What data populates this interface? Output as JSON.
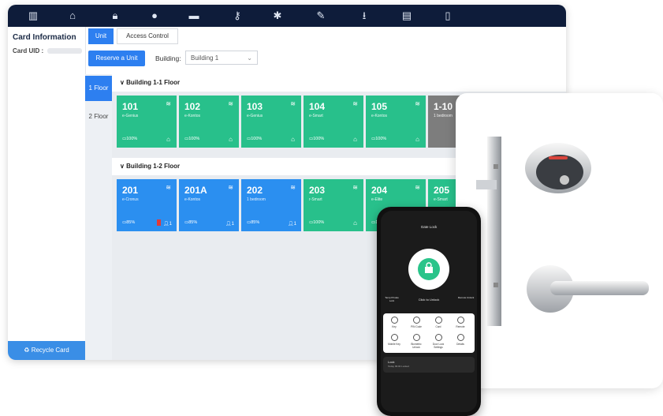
{
  "app": {
    "sidebar": {
      "title": "Card Information",
      "uid_label": "Card UID :",
      "recycle_label": "Recycle Card"
    },
    "tabs": [
      {
        "label": "Unit",
        "active": true
      },
      {
        "label": "Access Control",
        "active": false
      }
    ],
    "toolbar": {
      "reserve_label": "Reserve a Unit",
      "building_label": "Building:",
      "building_value": "Building 1"
    },
    "floors": [
      {
        "label": "1 Floor",
        "active": true
      },
      {
        "label": "2 Floor",
        "active": false
      }
    ],
    "sections": [
      {
        "title": "Building 1-1 Floor",
        "rooms": [
          {
            "num": "101",
            "type": "e-Genius",
            "battery": "100%",
            "color": "green"
          },
          {
            "num": "102",
            "type": "e-Kontos",
            "battery": "100%",
            "color": "green"
          },
          {
            "num": "103",
            "type": "e-Genius",
            "battery": "100%",
            "color": "green"
          },
          {
            "num": "104",
            "type": "e-Smart",
            "battery": "100%",
            "color": "green"
          },
          {
            "num": "105",
            "type": "e-Kontos",
            "battery": "100%",
            "color": "green"
          },
          {
            "num": "1-10",
            "type": "1 bedroom",
            "battery": "",
            "color": "gray"
          }
        ]
      },
      {
        "title": "Building 1-2 Floor",
        "rooms": [
          {
            "num": "201",
            "type": "e-Cronus",
            "battery": "85%",
            "color": "blue",
            "people": "1"
          },
          {
            "num": "201A",
            "type": "e-Kontos",
            "battery": "85%",
            "color": "blue",
            "people": "1"
          },
          {
            "num": "202",
            "type": "1 bedroom",
            "battery": "85%",
            "color": "blue",
            "people": "1"
          },
          {
            "num": "203",
            "type": "r-Smart",
            "battery": "100%",
            "color": "green"
          },
          {
            "num": "204",
            "type": "e-Elite",
            "battery": "100%",
            "color": "green"
          },
          {
            "num": "205",
            "type": "e-Smart",
            "battery": "",
            "color": "green"
          }
        ]
      }
    ]
  },
  "phone": {
    "header": "Gate Lock",
    "unlock_hint": "Click to Unlock",
    "side_left": "Temp Private Lock",
    "side_right": "Remote Unlock",
    "menu": [
      {
        "label": "Key"
      },
      {
        "label": "PIN Code"
      },
      {
        "label": "Card"
      },
      {
        "label": "Remote"
      },
      {
        "label": "Mobile Key"
      },
      {
        "label": "Biometric Unlock"
      },
      {
        "label": "Door Lock Settings"
      },
      {
        "label": "Details"
      }
    ],
    "lock_title": "Lock",
    "lock_subtitle": "Today 09:00 Locked"
  },
  "colors": {
    "topbar": "#0e1c3a",
    "accent": "#2d7ff0",
    "green_room": "#28c08b",
    "blue_room": "#2b8ff0",
    "gray_room": "#7d7d7d"
  },
  "icons": [
    "building-icon",
    "home-icon",
    "lock-icon",
    "user-icon",
    "card-icon",
    "key-icon",
    "gear-icon",
    "edit-icon",
    "download-icon",
    "document-icon",
    "device-icon"
  ]
}
